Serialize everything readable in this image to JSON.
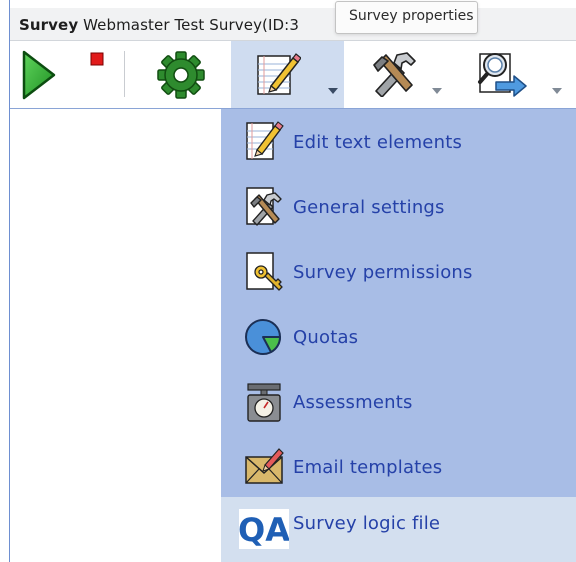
{
  "title_bar": {
    "label": "Survey",
    "survey_name": "Webmaster Test Survey(ID:3"
  },
  "tooltip": {
    "text": "Survey properties"
  },
  "toolbar": {
    "buttons": [
      {
        "name": "activate",
        "icon": "play-icon"
      },
      {
        "name": "stop",
        "icon": "stop-icon"
      },
      {
        "name": "settings",
        "icon": "gear-icon"
      },
      {
        "name": "survey-properties",
        "icon": "edit-document-icon",
        "active": true
      },
      {
        "name": "tools",
        "icon": "tools-icon"
      },
      {
        "name": "display-export",
        "icon": "magnifier-export-icon"
      }
    ]
  },
  "menu": {
    "background": "#a8bde6",
    "items": [
      {
        "label": "Edit text elements",
        "icon": "edit-document-icon"
      },
      {
        "label": "General settings",
        "icon": "tools-document-icon"
      },
      {
        "label": "Survey permissions",
        "icon": "key-document-icon"
      },
      {
        "label": "Quotas",
        "icon": "pie-chart-icon"
      },
      {
        "label": "Assessments",
        "icon": "scale-icon"
      },
      {
        "label": "Email templates",
        "icon": "envelope-icon"
      },
      {
        "label": "Survey logic file",
        "icon": "qa-icon",
        "badge": "QA"
      }
    ]
  },
  "colors": {
    "menu_link": "#2541a8",
    "menu_highlight": "#d3dfef",
    "active_toolbar_button": "#cfdcf0",
    "frame_border": "#6e8fd1"
  }
}
